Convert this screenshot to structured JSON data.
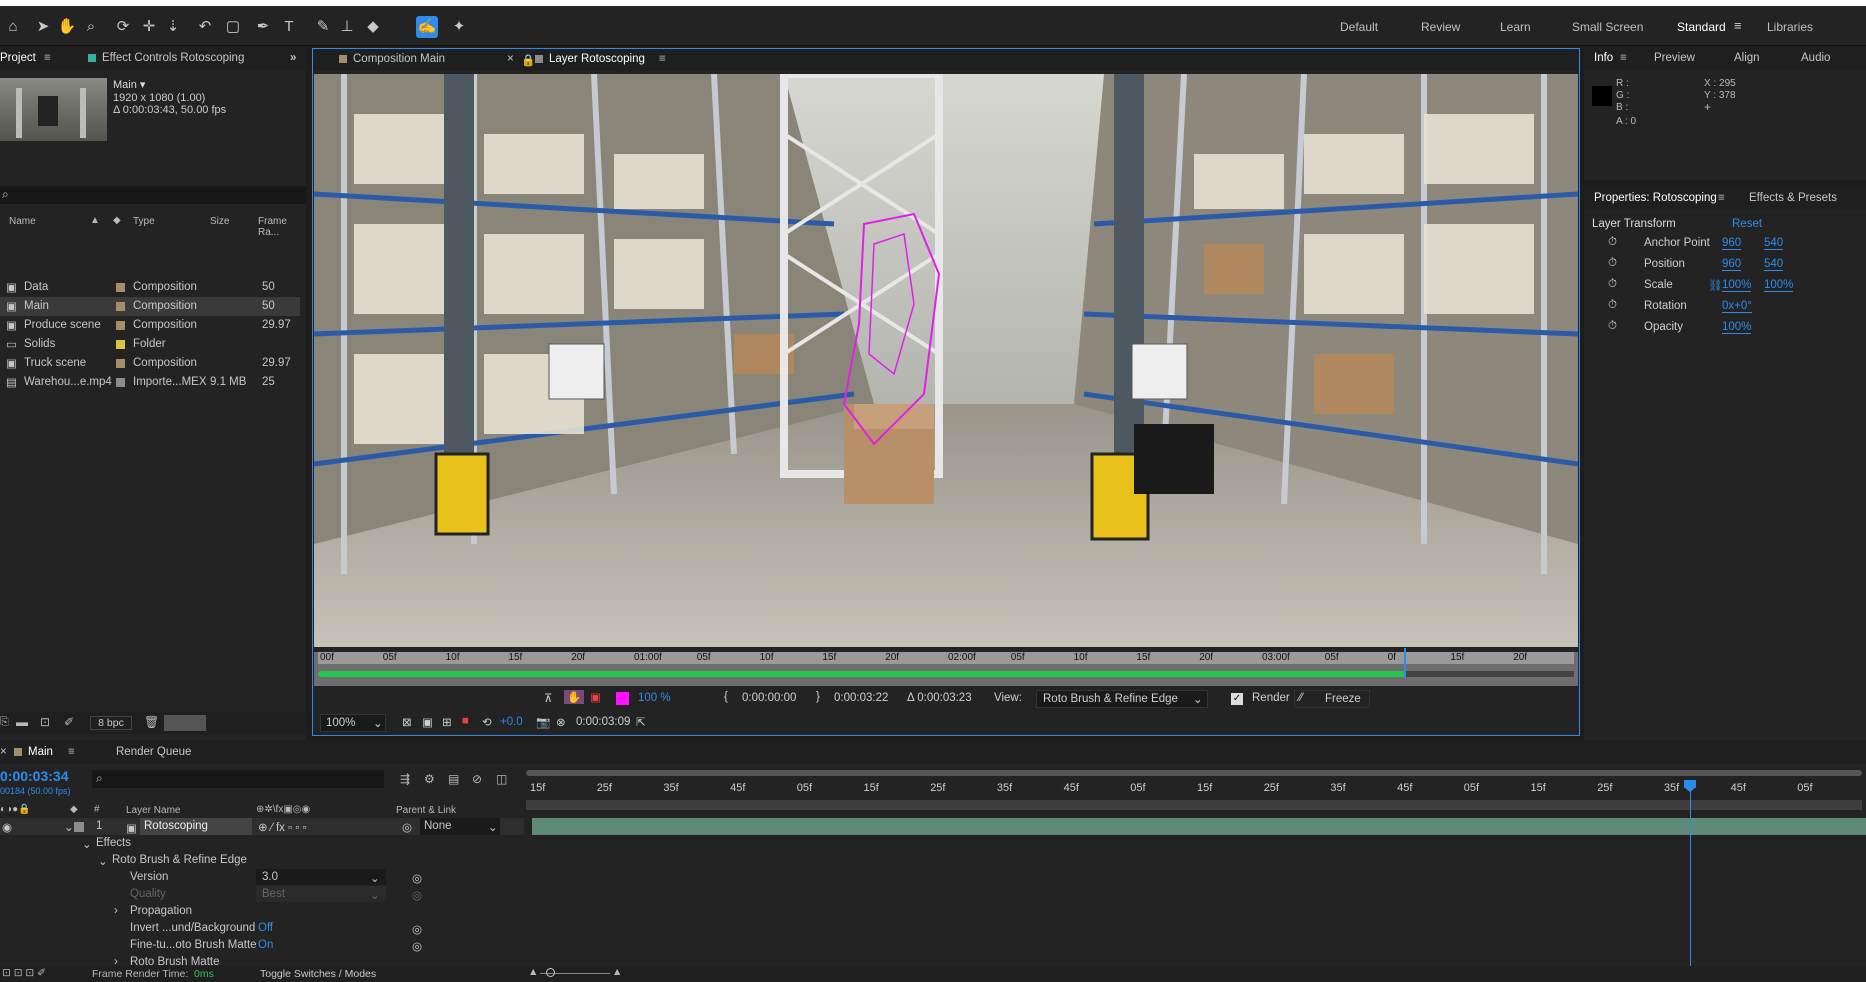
{
  "toolbar": {
    "tools": [
      "home-icon",
      "selection-arrow-icon",
      "hand-icon",
      "zoom-icon",
      "rotate-icon",
      "camera-orbit-icon",
      "pan-behind-icon",
      "undo-icon",
      "rectangle-icon",
      "pen-icon",
      "type-icon",
      "brush-icon",
      "clone-stamp-icon",
      "eraser-icon",
      "roto-brush-icon",
      "puppet-pin-icon"
    ],
    "workspaces": [
      "Default",
      "Review",
      "Learn",
      "Small Screen",
      "Standard",
      "Libraries"
    ],
    "active_workspace": "Standard"
  },
  "project": {
    "tab_label": "Project",
    "effect_controls_label": "Effect Controls Rotoscoping",
    "comp_name": "Main",
    "comp_res": "1920 x 1080 (1.00)",
    "comp_duration": "Δ 0:00:03:43, 50.00 fps",
    "search_placeholder": "",
    "columns": {
      "name": "Name",
      "type": "Type",
      "size": "Size",
      "frame_rate": "Frame Ra..."
    },
    "items": [
      {
        "name": "Data",
        "type": "Composition",
        "size": "",
        "fps": "50",
        "color": "#a58c6a"
      },
      {
        "name": "Main",
        "type": "Composition",
        "size": "",
        "fps": "50",
        "color": "#a58c6a"
      },
      {
        "name": "Produce scene",
        "type": "Composition",
        "size": "",
        "fps": "29.97",
        "color": "#a58c6a"
      },
      {
        "name": "Solids",
        "type": "Folder",
        "size": "",
        "fps": "",
        "color": "#d8c443"
      },
      {
        "name": "Truck scene",
        "type": "Composition",
        "size": "",
        "fps": "29.97",
        "color": "#a58c6a"
      },
      {
        "name": "Warehou...e.mp4",
        "type": "Importe...MEX",
        "size": "9.1 MB",
        "fps": "25",
        "color": "#8c8c8c"
      }
    ],
    "bpc": "8 bpc"
  },
  "viewer": {
    "tab1": "Composition Main",
    "tab2": "Layer Rotoscoping",
    "ruler_labels": [
      "00f",
      "05f",
      "10f",
      "15f",
      "20f",
      "01:00f",
      "05f",
      "10f",
      "15f",
      "20f",
      "02:00f",
      "05f",
      "10f",
      "15f",
      "20f",
      "03:00f",
      "05f",
      "0f",
      "15f",
      "20f"
    ],
    "zoom": "100%",
    "exposure": "+0.0",
    "current_time": "0:00:03:09",
    "roto_zoom": "100 %",
    "in_time": "0:00:00:00",
    "out_time": "0:00:03:22",
    "duration": "Δ 0:00:03:23",
    "view_label": "View:",
    "view_value": "Roto Brush & Refine Edge",
    "render_label": "Render",
    "freeze_label": "Freeze"
  },
  "info": {
    "tabs": [
      "Info",
      "Preview",
      "Align",
      "Audio"
    ],
    "r": "R :",
    "g": "G :",
    "b": "B :",
    "a": "A : 0",
    "x": "X : 295",
    "y": "Y : 378"
  },
  "properties": {
    "tab": "Properties: Rotoscoping",
    "tab2": "Effects & Presets",
    "section": "Layer Transform",
    "reset": "Reset",
    "rows": [
      {
        "label": "Anchor Point",
        "v1": "960",
        "v2": "540"
      },
      {
        "label": "Position",
        "v1": "960",
        "v2": "540"
      },
      {
        "label": "Scale",
        "v1": "100%",
        "v2": "100%"
      },
      {
        "label": "Rotation",
        "v1": "0x+0°",
        "v2": ""
      },
      {
        "label": "Opacity",
        "v1": "100%",
        "v2": ""
      }
    ]
  },
  "timeline": {
    "tab": "Main",
    "render_queue": "Render Queue",
    "timecode": "0:00:03:34",
    "frames": "00184 (50.00 fps)",
    "layer_name_col": "Layer Name",
    "parent_col": "Parent & Link",
    "layer_num": "1",
    "layer_name": "Rotoscoping",
    "parent_value": "None",
    "effects_label": "Effects",
    "roto_label": "Roto Brush & Refine Edge",
    "version_label": "Version",
    "version_value": "3.0",
    "quality_label": "Quality",
    "quality_value": "Best",
    "propagation_label": "Propagation",
    "invert_label": "Invert ...und/Background",
    "invert_value": "Off",
    "finetune_label": "Fine-tu...oto Brush Matte",
    "finetune_value": "On",
    "roto_matte_label": "Roto Brush Matte",
    "ruler_labels": [
      "15f",
      "25f",
      "35f",
      "45f",
      "05f",
      "15f",
      "25f",
      "35f",
      "45f",
      "05f",
      "15f",
      "25f",
      "35f",
      "45f",
      "05f",
      "15f",
      "25f",
      "35f",
      "45f",
      "05f"
    ],
    "footer_render_label": "Frame Render Time:",
    "footer_render_value": "0ms",
    "toggle_label": "Toggle Switches / Modes"
  }
}
